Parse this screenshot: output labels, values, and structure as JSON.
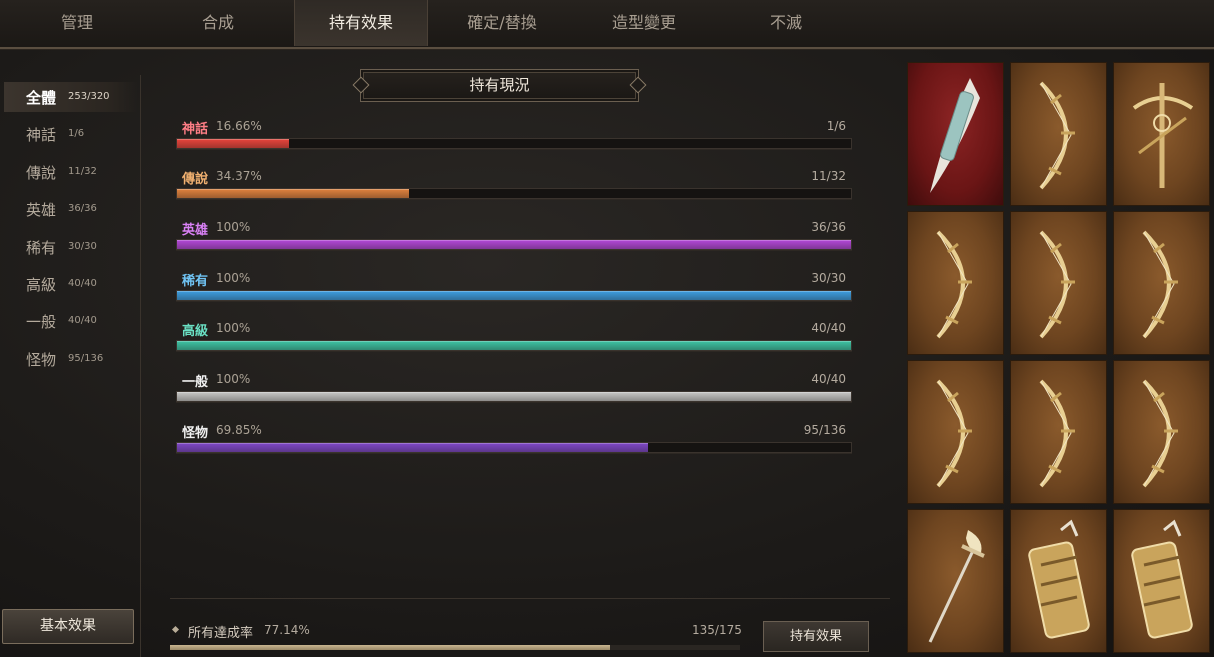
{
  "tabs": [
    {
      "label": "管理",
      "active": false
    },
    {
      "label": "合成",
      "active": false
    },
    {
      "label": "持有效果",
      "active": true
    },
    {
      "label": "確定/替換",
      "active": false
    },
    {
      "label": "造型變更",
      "active": false
    },
    {
      "label": "不滅",
      "active": false
    }
  ],
  "categories": [
    {
      "name": "全體",
      "count": "253/320",
      "active": true
    },
    {
      "name": "神話",
      "count": "1/6",
      "active": false
    },
    {
      "name": "傳說",
      "count": "11/32",
      "active": false
    },
    {
      "name": "英雄",
      "count": "36/36",
      "active": false
    },
    {
      "name": "稀有",
      "count": "30/30",
      "active": false
    },
    {
      "name": "高級",
      "count": "40/40",
      "active": false
    },
    {
      "name": "一般",
      "count": "40/40",
      "active": false
    },
    {
      "name": "怪物",
      "count": "95/136",
      "active": false
    }
  ],
  "basic_effect_button": "基本效果",
  "section_title": "持有現況",
  "rows": [
    {
      "label": "神話",
      "percent": "16.66%",
      "count": "1/6",
      "fill": 0.1666,
      "color": "#e8453c"
    },
    {
      "label": "傳說",
      "percent": "34.37%",
      "count": "11/32",
      "fill": 0.3437,
      "color": "#e0823e"
    },
    {
      "label": "英雄",
      "percent": "100%",
      "count": "36/36",
      "fill": 1.0,
      "color": "#b448d8"
    },
    {
      "label": "稀有",
      "percent": "100%",
      "count": "30/30",
      "fill": 1.0,
      "color": "#3e9ee0"
    },
    {
      "label": "高級",
      "percent": "100%",
      "count": "40/40",
      "fill": 1.0,
      "color": "#3ec4a4"
    },
    {
      "label": "一般",
      "percent": "100%",
      "count": "40/40",
      "fill": 1.0,
      "color": "#c8c8c6"
    },
    {
      "label": "怪物",
      "percent": "69.85%",
      "count": "95/136",
      "fill": 0.6985,
      "color": "#8048c8"
    }
  ],
  "label_colors": {
    "神話": "#ff7e86",
    "傳說": "#f0b070",
    "英雄": "#d880f4",
    "稀有": "#70c4f4",
    "高級": "#6ae0c4",
    "一般": "#f0f0f0",
    "怪物": "#f0f0f0"
  },
  "total": {
    "label": "所有達成率",
    "percent": "77.14%",
    "count": "135/175",
    "fill": 0.7714
  },
  "effect_button": "持有效果",
  "items": [
    {
      "icon": "dagger-icon",
      "frame": "red"
    },
    {
      "icon": "bow-icon",
      "frame": "gold"
    },
    {
      "icon": "crossbow-icon",
      "frame": "gold"
    },
    {
      "icon": "bow-icon",
      "frame": "gold"
    },
    {
      "icon": "bow-icon",
      "frame": "gold"
    },
    {
      "icon": "bow-icon",
      "frame": "gold"
    },
    {
      "icon": "bow-icon",
      "frame": "gold"
    },
    {
      "icon": "bow-icon",
      "frame": "gold"
    },
    {
      "icon": "bow-icon",
      "frame": "gold"
    },
    {
      "icon": "spear-icon",
      "frame": "gold"
    },
    {
      "icon": "gauntlet-icon",
      "frame": "gold"
    },
    {
      "icon": "gauntlet-icon",
      "frame": "gold"
    }
  ]
}
